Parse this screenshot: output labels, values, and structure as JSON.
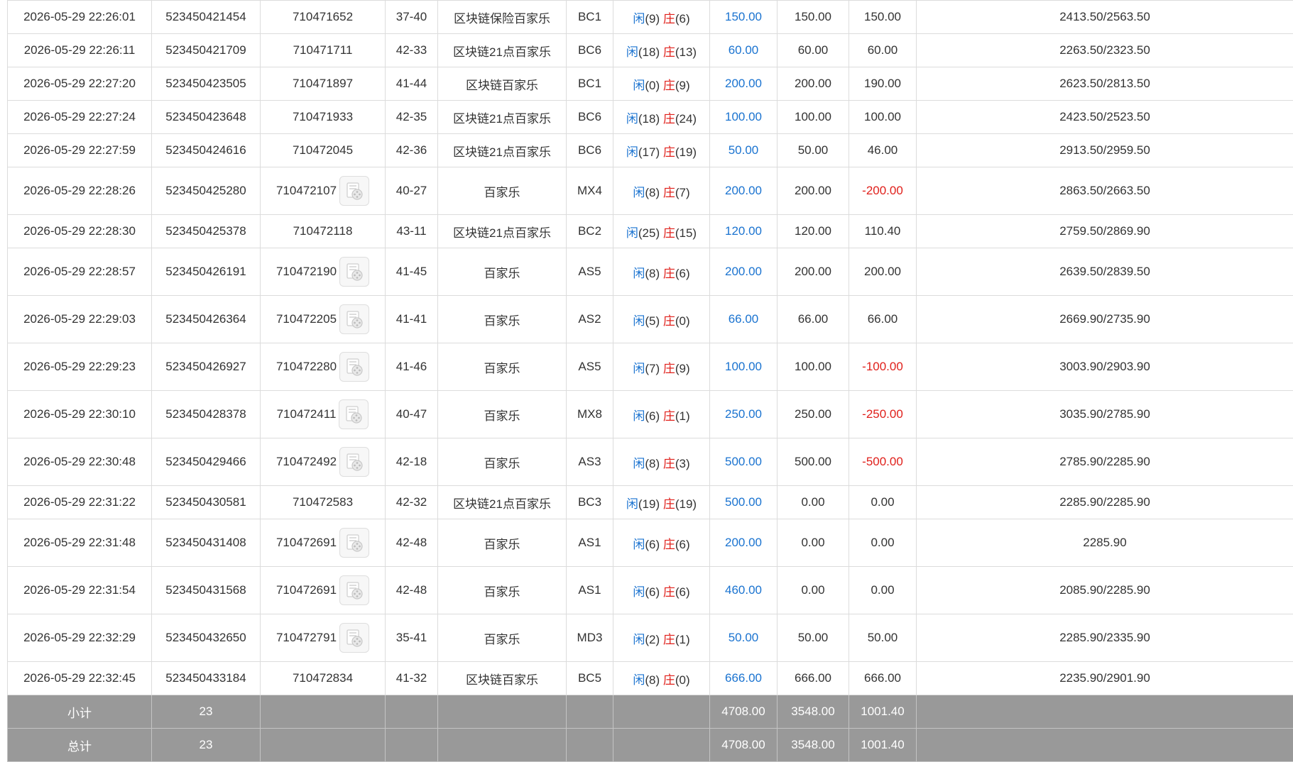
{
  "colors": {
    "blue_text": "#1a73d0",
    "red_text": "#e0201b",
    "total_row_bg": "#999999",
    "grid_border": "#dcdcdc"
  },
  "rows": [
    {
      "time": "2026-05-29 22:26:01",
      "bet_no": "523450421454",
      "game_no": "710471652",
      "shoe_round": "37-40",
      "game": "区块链保险百家乐",
      "table": "BC1",
      "xian_label": "闲",
      "xian_val": "(9)",
      "zhuang_label": "庄",
      "zhuang_val": "(6)",
      "bet": "150.00",
      "valid": "150.00",
      "win": "150.00",
      "win_neg": false,
      "balance": "2413.50/2563.50",
      "video": false
    },
    {
      "time": "2026-05-29 22:26:11",
      "bet_no": "523450421709",
      "game_no": "710471711",
      "shoe_round": "42-33",
      "game": "区块链21点百家乐",
      "table": "BC6",
      "xian_label": "闲",
      "xian_val": "(18)",
      "zhuang_label": "庄",
      "zhuang_val": "(13)",
      "bet": "60.00",
      "valid": "60.00",
      "win": "60.00",
      "win_neg": false,
      "balance": "2263.50/2323.50",
      "video": false
    },
    {
      "time": "2026-05-29 22:27:20",
      "bet_no": "523450423505",
      "game_no": "710471897",
      "shoe_round": "41-44",
      "game": "区块链百家乐",
      "table": "BC1",
      "xian_label": "闲",
      "xian_val": "(0)",
      "zhuang_label": "庄",
      "zhuang_val": "(9)",
      "bet": "200.00",
      "valid": "200.00",
      "win": "190.00",
      "win_neg": false,
      "balance": "2623.50/2813.50",
      "video": false
    },
    {
      "time": "2026-05-29 22:27:24",
      "bet_no": "523450423648",
      "game_no": "710471933",
      "shoe_round": "42-35",
      "game": "区块链21点百家乐",
      "table": "BC6",
      "xian_label": "闲",
      "xian_val": "(18)",
      "zhuang_label": "庄",
      "zhuang_val": "(24)",
      "bet": "100.00",
      "valid": "100.00",
      "win": "100.00",
      "win_neg": false,
      "balance": "2423.50/2523.50",
      "video": false
    },
    {
      "time": "2026-05-29 22:27:59",
      "bet_no": "523450424616",
      "game_no": "710472045",
      "shoe_round": "42-36",
      "game": "区块链21点百家乐",
      "table": "BC6",
      "xian_label": "闲",
      "xian_val": "(17)",
      "zhuang_label": "庄",
      "zhuang_val": "(19)",
      "bet": "50.00",
      "valid": "50.00",
      "win": "46.00",
      "win_neg": false,
      "balance": "2913.50/2959.50",
      "video": false
    },
    {
      "time": "2026-05-29 22:28:26",
      "bet_no": "523450425280",
      "game_no": "710472107",
      "shoe_round": "40-27",
      "game": "百家乐",
      "table": "MX4",
      "xian_label": "闲",
      "xian_val": "(8)",
      "zhuang_label": "庄",
      "zhuang_val": "(7)",
      "bet": "200.00",
      "valid": "200.00",
      "win": "-200.00",
      "win_neg": true,
      "balance": "2863.50/2663.50",
      "video": true
    },
    {
      "time": "2026-05-29 22:28:30",
      "bet_no": "523450425378",
      "game_no": "710472118",
      "shoe_round": "43-11",
      "game": "区块链21点百家乐",
      "table": "BC2",
      "xian_label": "闲",
      "xian_val": "(25)",
      "zhuang_label": "庄",
      "zhuang_val": "(15)",
      "bet": "120.00",
      "valid": "120.00",
      "win": "110.40",
      "win_neg": false,
      "balance": "2759.50/2869.90",
      "video": false
    },
    {
      "time": "2026-05-29 22:28:57",
      "bet_no": "523450426191",
      "game_no": "710472190",
      "shoe_round": "41-45",
      "game": "百家乐",
      "table": "AS5",
      "xian_label": "闲",
      "xian_val": "(8)",
      "zhuang_label": "庄",
      "zhuang_val": "(6)",
      "bet": "200.00",
      "valid": "200.00",
      "win": "200.00",
      "win_neg": false,
      "balance": "2639.50/2839.50",
      "video": true
    },
    {
      "time": "2026-05-29 22:29:03",
      "bet_no": "523450426364",
      "game_no": "710472205",
      "shoe_round": "41-41",
      "game": "百家乐",
      "table": "AS2",
      "xian_label": "闲",
      "xian_val": "(5)",
      "zhuang_label": "庄",
      "zhuang_val": "(0)",
      "bet": "66.00",
      "valid": "66.00",
      "win": "66.00",
      "win_neg": false,
      "balance": "2669.90/2735.90",
      "video": true
    },
    {
      "time": "2026-05-29 22:29:23",
      "bet_no": "523450426927",
      "game_no": "710472280",
      "shoe_round": "41-46",
      "game": "百家乐",
      "table": "AS5",
      "xian_label": "闲",
      "xian_val": "(7)",
      "zhuang_label": "庄",
      "zhuang_val": "(9)",
      "bet": "100.00",
      "valid": "100.00",
      "win": "-100.00",
      "win_neg": true,
      "balance": "3003.90/2903.90",
      "video": true
    },
    {
      "time": "2026-05-29 22:30:10",
      "bet_no": "523450428378",
      "game_no": "710472411",
      "shoe_round": "40-47",
      "game": "百家乐",
      "table": "MX8",
      "xian_label": "闲",
      "xian_val": "(6)",
      "zhuang_label": "庄",
      "zhuang_val": "(1)",
      "bet": "250.00",
      "valid": "250.00",
      "win": "-250.00",
      "win_neg": true,
      "balance": "3035.90/2785.90",
      "video": true
    },
    {
      "time": "2026-05-29 22:30:48",
      "bet_no": "523450429466",
      "game_no": "710472492",
      "shoe_round": "42-18",
      "game": "百家乐",
      "table": "AS3",
      "xian_label": "闲",
      "xian_val": "(8)",
      "zhuang_label": "庄",
      "zhuang_val": "(3)",
      "bet": "500.00",
      "valid": "500.00",
      "win": "-500.00",
      "win_neg": true,
      "balance": "2785.90/2285.90",
      "video": true
    },
    {
      "time": "2026-05-29 22:31:22",
      "bet_no": "523450430581",
      "game_no": "710472583",
      "shoe_round": "42-32",
      "game": "区块链21点百家乐",
      "table": "BC3",
      "xian_label": "闲",
      "xian_val": "(19)",
      "zhuang_label": "庄",
      "zhuang_val": "(19)",
      "bet": "500.00",
      "valid": "0.00",
      "win": "0.00",
      "win_neg": false,
      "balance": "2285.90/2285.90",
      "video": false
    },
    {
      "time": "2026-05-29 22:31:48",
      "bet_no": "523450431408",
      "game_no": "710472691",
      "shoe_round": "42-48",
      "game": "百家乐",
      "table": "AS1",
      "xian_label": "闲",
      "xian_val": "(6)",
      "zhuang_label": "庄",
      "zhuang_val": "(6)",
      "bet": "200.00",
      "valid": "0.00",
      "win": "0.00",
      "win_neg": false,
      "balance": "2285.90",
      "video": true
    },
    {
      "time": "2026-05-29 22:31:54",
      "bet_no": "523450431568",
      "game_no": "710472691",
      "shoe_round": "42-48",
      "game": "百家乐",
      "table": "AS1",
      "xian_label": "闲",
      "xian_val": "(6)",
      "zhuang_label": "庄",
      "zhuang_val": "(6)",
      "bet": "460.00",
      "valid": "0.00",
      "win": "0.00",
      "win_neg": false,
      "balance": "2085.90/2285.90",
      "video": true
    },
    {
      "time": "2026-05-29 22:32:29",
      "bet_no": "523450432650",
      "game_no": "710472791",
      "shoe_round": "35-41",
      "game": "百家乐",
      "table": "MD3",
      "xian_label": "闲",
      "xian_val": "(2)",
      "zhuang_label": "庄",
      "zhuang_val": "(1)",
      "bet": "50.00",
      "valid": "50.00",
      "win": "50.00",
      "win_neg": false,
      "balance": "2285.90/2335.90",
      "video": true
    },
    {
      "time": "2026-05-29 22:32:45",
      "bet_no": "523450433184",
      "game_no": "710472834",
      "shoe_round": "41-32",
      "game": "区块链百家乐",
      "table": "BC5",
      "xian_label": "闲",
      "xian_val": "(8)",
      "zhuang_label": "庄",
      "zhuang_val": "(0)",
      "bet": "666.00",
      "valid": "666.00",
      "win": "666.00",
      "win_neg": false,
      "balance": "2235.90/2901.90",
      "video": false
    }
  ],
  "subtotal": {
    "label": "小计",
    "count": "23",
    "bet": "4708.00",
    "valid": "3548.00",
    "win": "1001.40"
  },
  "total": {
    "label": "总计",
    "count": "23",
    "bet": "4708.00",
    "valid": "3548.00",
    "win": "1001.40"
  },
  "icons": {
    "video_replay": "video-replay-icon"
  }
}
